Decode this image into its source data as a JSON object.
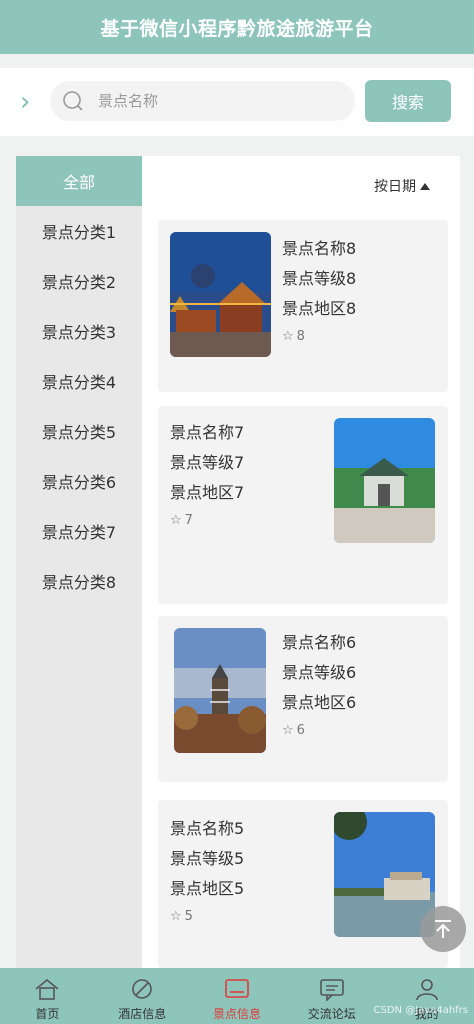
{
  "header": {
    "title": "基于微信小程序黔旅途旅游平台"
  },
  "search": {
    "placeholder": "景点名称",
    "button_label": "搜索"
  },
  "sidebar": {
    "items": [
      {
        "label": "全部",
        "active": true
      },
      {
        "label": "景点分类1"
      },
      {
        "label": "景点分类2"
      },
      {
        "label": "景点分类3"
      },
      {
        "label": "景点分类4"
      },
      {
        "label": "景点分类5"
      },
      {
        "label": "景点分类6"
      },
      {
        "label": "景点分类7"
      },
      {
        "label": "景点分类8"
      }
    ]
  },
  "sort": {
    "label": "按日期"
  },
  "cards": [
    {
      "name": "景点名称8",
      "level": "景点等级8",
      "region": "景点地区8",
      "likes": "8"
    },
    {
      "name": "景点名称7",
      "level": "景点等级7",
      "region": "景点地区7",
      "likes": "7"
    },
    {
      "name": "景点名称6",
      "level": "景点等级6",
      "region": "景点地区6",
      "likes": "6"
    },
    {
      "name": "景点名称5",
      "level": "景点等级5",
      "region": "景点地区5",
      "likes": "5"
    }
  ],
  "tabbar": {
    "items": [
      {
        "label": "首页",
        "icon": "home-icon"
      },
      {
        "label": "酒店信息",
        "icon": "hotel-icon"
      },
      {
        "label": "景点信息",
        "icon": "scenic-icon",
        "active": true
      },
      {
        "label": "交流论坛",
        "icon": "forum-icon"
      },
      {
        "label": "我的",
        "icon": "user-icon"
      }
    ]
  },
  "watermark": "CSDN @Java4ahfrs",
  "colors": {
    "accent": "#8ec5bb",
    "active_tab": "#e03a3a"
  }
}
